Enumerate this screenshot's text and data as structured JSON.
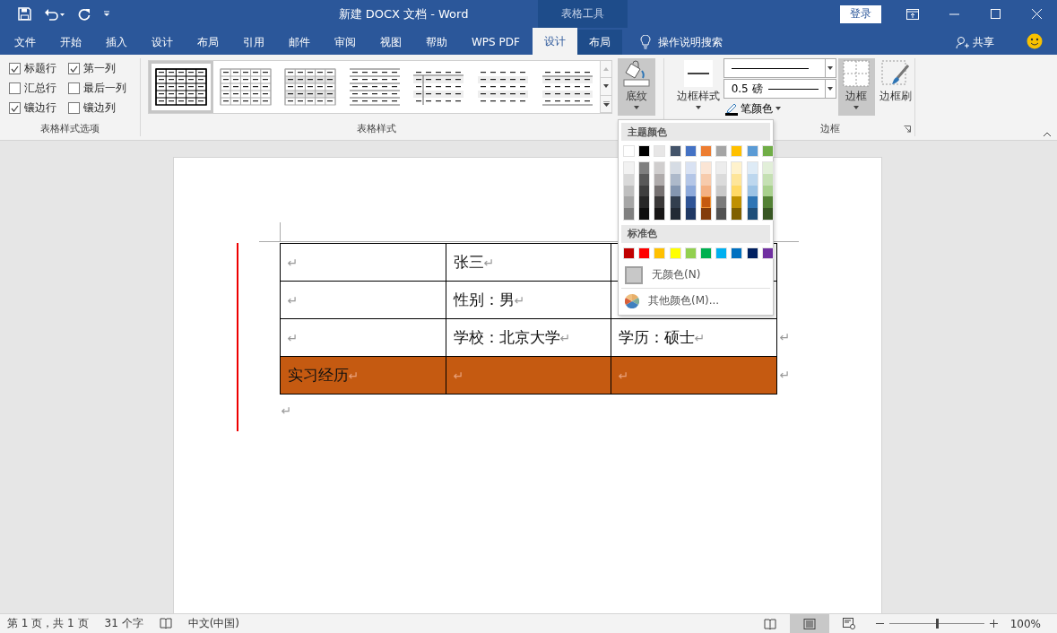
{
  "title_bar": {
    "title": "新建 DOCX 文档  -  Word",
    "context_label": "表格工具",
    "sign_in": "登录"
  },
  "tabs": [
    {
      "label": "文件",
      "selected": false,
      "kind": "normal"
    },
    {
      "label": "开始",
      "selected": false,
      "kind": "normal"
    },
    {
      "label": "插入",
      "selected": false,
      "kind": "normal"
    },
    {
      "label": "设计",
      "selected": false,
      "kind": "normal"
    },
    {
      "label": "布局",
      "selected": false,
      "kind": "normal"
    },
    {
      "label": "引用",
      "selected": false,
      "kind": "normal"
    },
    {
      "label": "邮件",
      "selected": false,
      "kind": "normal"
    },
    {
      "label": "审阅",
      "selected": false,
      "kind": "normal"
    },
    {
      "label": "视图",
      "selected": false,
      "kind": "normal"
    },
    {
      "label": "帮助",
      "selected": false,
      "kind": "normal"
    },
    {
      "label": "WPS PDF",
      "selected": false,
      "kind": "normal"
    },
    {
      "label": "设计",
      "selected": true,
      "kind": "context"
    },
    {
      "label": "布局",
      "selected": false,
      "kind": "context"
    }
  ],
  "search": {
    "label": "操作说明搜索"
  },
  "share": {
    "label": "共享"
  },
  "ribbon": {
    "style_options": {
      "group_label": "表格样式选项",
      "items": [
        {
          "label": "标题行",
          "checked": true
        },
        {
          "label": "第一列",
          "checked": true
        },
        {
          "label": "汇总行",
          "checked": false
        },
        {
          "label": "最后一列",
          "checked": false
        },
        {
          "label": "镶边行",
          "checked": true
        },
        {
          "label": "镶边列",
          "checked": false
        }
      ]
    },
    "table_styles": {
      "group_label": "表格样式",
      "items": [
        {
          "kind": "grid-bold",
          "selected": true
        },
        {
          "kind": "grid-light",
          "selected": false
        },
        {
          "kind": "grid-shaded",
          "selected": false
        },
        {
          "kind": "lines",
          "selected": false
        },
        {
          "kind": "first-column",
          "selected": false
        },
        {
          "kind": "banded",
          "selected": false
        },
        {
          "kind": "banded-lines",
          "selected": false
        }
      ]
    },
    "shading": {
      "label": "底纹",
      "pressed": true
    },
    "border_styles": {
      "label": "边框样式"
    },
    "line_weight": "0.5 磅",
    "pen_color": {
      "label": "笔颜色"
    },
    "borders": {
      "label": "边框",
      "pressed": true
    },
    "border_painter": {
      "label": "边框刷"
    },
    "border_group_label": "边框"
  },
  "color_menu": {
    "theme_header": "主题颜色",
    "theme_columns": [
      {
        "color": "#ffffff",
        "selected": false,
        "shades": [
          {
            "color": "#f2f2f2",
            "selected": false
          },
          {
            "color": "#d9d9d9",
            "selected": false
          },
          {
            "color": "#bfbfbf",
            "selected": false
          },
          {
            "color": "#a6a6a6",
            "selected": false
          },
          {
            "color": "#808080",
            "selected": false
          }
        ]
      },
      {
        "color": "#000000",
        "selected": false,
        "shades": [
          {
            "color": "#7f7f7f",
            "selected": false
          },
          {
            "color": "#595959",
            "selected": false
          },
          {
            "color": "#3f3f3f",
            "selected": false
          },
          {
            "color": "#262626",
            "selected": false
          },
          {
            "color": "#0d0d0d",
            "selected": false
          }
        ]
      },
      {
        "color": "#e7e6e6",
        "selected": false,
        "shades": [
          {
            "color": "#d0cece",
            "selected": false
          },
          {
            "color": "#afabab",
            "selected": false
          },
          {
            "color": "#767171",
            "selected": false
          },
          {
            "color": "#3a3838",
            "selected": false
          },
          {
            "color": "#171616",
            "selected": false
          }
        ]
      },
      {
        "color": "#44546a",
        "selected": false,
        "shades": [
          {
            "color": "#d6dce4",
            "selected": false
          },
          {
            "color": "#adb9ca",
            "selected": false
          },
          {
            "color": "#8496b0",
            "selected": false
          },
          {
            "color": "#333f4f",
            "selected": false
          },
          {
            "color": "#222a35",
            "selected": false
          }
        ]
      },
      {
        "color": "#4472c4",
        "selected": false,
        "shades": [
          {
            "color": "#d9e2f3",
            "selected": false
          },
          {
            "color": "#b4c6e7",
            "selected": false
          },
          {
            "color": "#8eaadb",
            "selected": false
          },
          {
            "color": "#2f5496",
            "selected": false
          },
          {
            "color": "#1f3864",
            "selected": false
          }
        ]
      },
      {
        "color": "#ed7d31",
        "selected": false,
        "shades": [
          {
            "color": "#fbe5d5",
            "selected": false
          },
          {
            "color": "#f7cbac",
            "selected": false
          },
          {
            "color": "#f4b183",
            "selected": false
          },
          {
            "color": "#c55a11",
            "selected": true
          },
          {
            "color": "#833c0b",
            "selected": false
          }
        ]
      },
      {
        "color": "#a5a5a5",
        "selected": false,
        "shades": [
          {
            "color": "#ededed",
            "selected": false
          },
          {
            "color": "#dbdbdb",
            "selected": false
          },
          {
            "color": "#c9c9c9",
            "selected": false
          },
          {
            "color": "#7b7b7b",
            "selected": false
          },
          {
            "color": "#525252",
            "selected": false
          }
        ]
      },
      {
        "color": "#ffc000",
        "selected": false,
        "shades": [
          {
            "color": "#fff2cc",
            "selected": false
          },
          {
            "color": "#fee599",
            "selected": false
          },
          {
            "color": "#ffd965",
            "selected": false
          },
          {
            "color": "#bf9000",
            "selected": false
          },
          {
            "color": "#7f6000",
            "selected": false
          }
        ]
      },
      {
        "color": "#5b9bd5",
        "selected": false,
        "shades": [
          {
            "color": "#deebf6",
            "selected": false
          },
          {
            "color": "#bdd7ee",
            "selected": false
          },
          {
            "color": "#9cc3e5",
            "selected": false
          },
          {
            "color": "#2e75b5",
            "selected": false
          },
          {
            "color": "#1e4e79",
            "selected": false
          }
        ]
      },
      {
        "color": "#70ad47",
        "selected": false,
        "shades": [
          {
            "color": "#e2efd9",
            "selected": false
          },
          {
            "color": "#c5e0b3",
            "selected": false
          },
          {
            "color": "#a8d08d",
            "selected": false
          },
          {
            "color": "#538135",
            "selected": false
          },
          {
            "color": "#375623",
            "selected": false
          }
        ]
      }
    ],
    "standard_header": "标准色",
    "standard_colors": [
      {
        "color": "#c00000",
        "selected": false
      },
      {
        "color": "#ff0000",
        "selected": false
      },
      {
        "color": "#ffc000",
        "selected": false
      },
      {
        "color": "#ffff00",
        "selected": false
      },
      {
        "color": "#92d050",
        "selected": false
      },
      {
        "color": "#00b050",
        "selected": false
      },
      {
        "color": "#00b0f0",
        "selected": false
      },
      {
        "color": "#0070c0",
        "selected": false
      },
      {
        "color": "#002060",
        "selected": false
      },
      {
        "color": "#7030a0",
        "selected": false
      }
    ],
    "no_color": "无颜色(N)",
    "more_colors": "其他颜色(M)..."
  },
  "document": {
    "table": {
      "rows": [
        {
          "cells": [
            {
              "text": "",
              "mark": "↵"
            },
            {
              "text": "张三",
              "mark": "↵"
            },
            {}
          ]
        },
        {
          "cells": [
            {
              "text": "",
              "mark": "↵"
            },
            {
              "text": "性别：男",
              "mark": "↵"
            },
            {}
          ]
        },
        {
          "cells": [
            {
              "text": "",
              "mark": "↵"
            },
            {
              "text": "学校：北京大学",
              "mark": "↵"
            },
            {
              "text": "学历：硕士",
              "mark": "↵"
            }
          ],
          "end_mark": "↵"
        },
        {
          "cells": [
            {
              "text": "实习经历",
              "mark": "↵",
              "color": "#c55a11"
            },
            {
              "text": "",
              "mark": "↵",
              "color": "#c55a11"
            },
            {
              "text": "",
              "mark": "↵",
              "color": "#c55a11"
            }
          ],
          "end_mark": "↵"
        }
      ]
    },
    "paragraph_mark": "↵"
  },
  "status_bar": {
    "page": "第 1 页，共 1 页",
    "words": "31 个字",
    "language": "中文(中国)",
    "views": [
      {
        "kind": "read",
        "selected": false
      },
      {
        "kind": "print",
        "selected": true
      },
      {
        "kind": "web",
        "selected": false
      }
    ],
    "zoom": {
      "level": 0.5,
      "label": "100%"
    }
  }
}
